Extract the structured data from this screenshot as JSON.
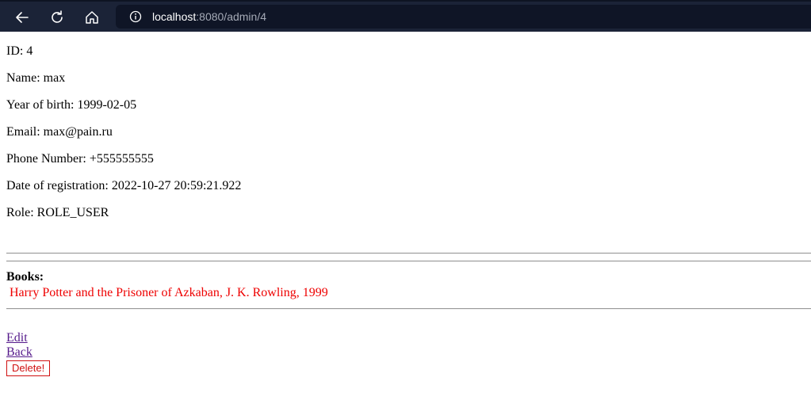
{
  "browser": {
    "url_host": "localhost",
    "url_rest": ":8080/admin/4"
  },
  "user": {
    "id": "ID: 4",
    "name": "Name: max",
    "year_of_birth": "Year of birth: 1999-02-05",
    "email": "Email: max@pain.ru",
    "phone": "Phone Number: +555555555",
    "registration": "Date of registration: 2022-10-27 20:59:21.922",
    "role": "Role: ROLE_USER"
  },
  "books": {
    "heading": "Books:",
    "items": [
      "Harry Potter and the Prisoner of Azkaban, J. K. Rowling, 1999"
    ]
  },
  "actions": {
    "edit_label": "Edit",
    "back_label": "Back",
    "delete_label": "Delete!"
  },
  "colors": {
    "toolbar": "#1b2337",
    "book_text": "#ee0000",
    "delete_border": "#d01010",
    "link": "#551a8b"
  }
}
